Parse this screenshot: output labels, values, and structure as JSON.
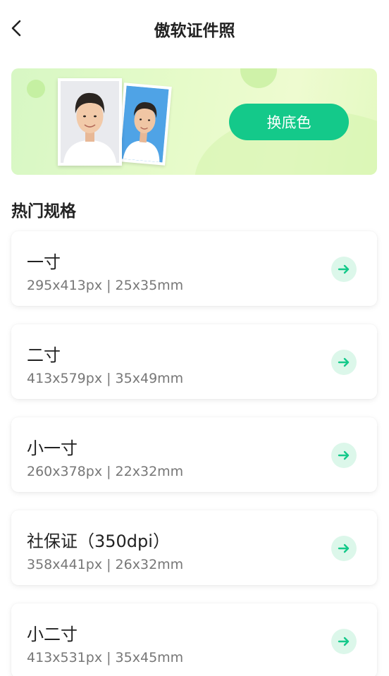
{
  "header": {
    "title": "傲软证件照"
  },
  "banner": {
    "button_label": "换底色"
  },
  "section": {
    "title": "热门规格"
  },
  "specs": [
    {
      "name": "一寸",
      "size": "295x413px | 25x35mm"
    },
    {
      "name": "二寸",
      "size": "413x579px | 35x49mm"
    },
    {
      "name": "小一寸",
      "size": "260x378px | 22x32mm"
    },
    {
      "name": "社保证（350dpi）",
      "size": "358x441px | 26x32mm"
    },
    {
      "name": "小二寸",
      "size": "413x531px | 35x45mm"
    }
  ],
  "colors": {
    "accent": "#14c98a",
    "arrow_bg": "#dcf7ea",
    "banner_bg": "#e6fbc9",
    "photo_blue": "#4fa3e6"
  },
  "icons": {
    "back": "chevron-left-icon",
    "arrow": "arrow-right-icon"
  }
}
